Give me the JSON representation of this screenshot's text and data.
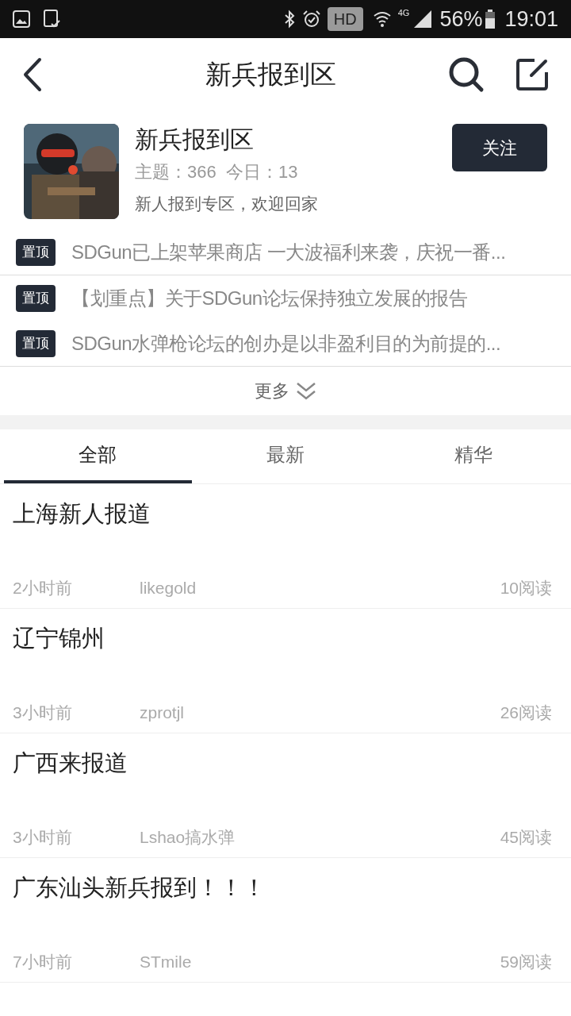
{
  "status_bar": {
    "hd": "HD",
    "network": "4G",
    "battery": "56%",
    "time": "19:01"
  },
  "header": {
    "title": "新兵报到区"
  },
  "forum": {
    "name": "新兵报到区",
    "stats": "主题：366  今日：13",
    "description": "新人报到专区，欢迎回家",
    "follow_button": "关注"
  },
  "pinned": [
    {
      "tag": "置顶",
      "title": "SDGun已上架苹果商店 一大波福利来袭，庆祝一番..."
    },
    {
      "tag": "置顶",
      "title": "【划重点】关于SDGun论坛保持独立发展的报告"
    },
    {
      "tag": "置顶",
      "title": "SDGun水弹枪论坛的创办是以非盈利目的为前提的..."
    }
  ],
  "more": "更多",
  "tabs": [
    {
      "label": "全部",
      "selected": true
    },
    {
      "label": "最新",
      "selected": false
    },
    {
      "label": "精华",
      "selected": false
    }
  ],
  "posts": [
    {
      "title": "上海新人报道",
      "time": "2小时前",
      "author": "likegold",
      "reads": "10阅读"
    },
    {
      "title": "辽宁锦州",
      "time": "3小时前",
      "author": "zprotjl",
      "reads": "26阅读"
    },
    {
      "title": "广西来报道",
      "time": "3小时前",
      "author": "Lshao搞水弹",
      "reads": "45阅读"
    },
    {
      "title": "广东汕头新兵报到！！！",
      "time": "7小时前",
      "author": "STmile",
      "reads": "59阅读"
    }
  ]
}
